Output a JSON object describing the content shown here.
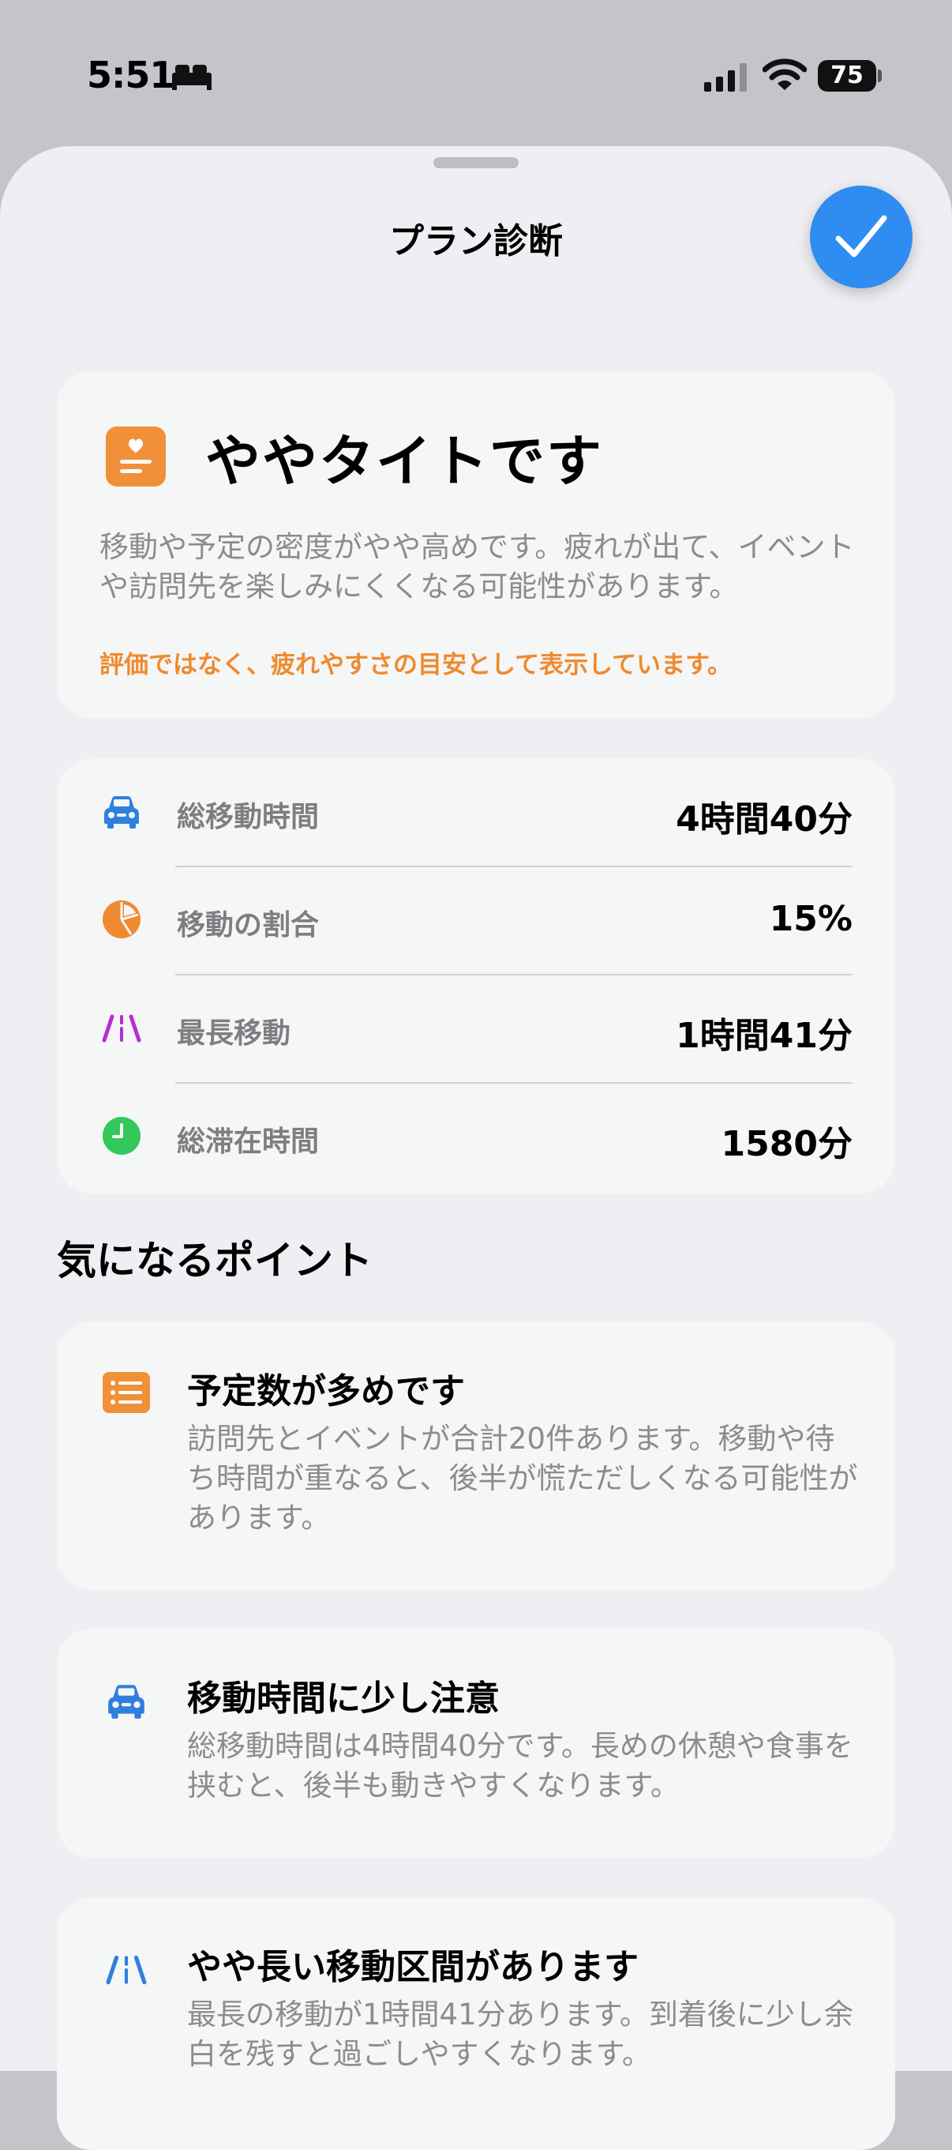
{
  "status_bar": {
    "time": "5:51",
    "battery": "75"
  },
  "sheet": {
    "title": "プラン診断"
  },
  "summary": {
    "title": "ややタイトです",
    "description": "移動や予定の密度がやや高めです。疲れが出て、イベントや訪問先を楽しみにくくなる可能性があります。",
    "note": "評価ではなく、疲れやすさの目安として表示しています。",
    "icon": "heart-document-icon",
    "accent": "#f0913a"
  },
  "stats": [
    {
      "icon": "car-icon",
      "color": "#2f7fe0",
      "label": "総移動時間",
      "value": "4時間40分"
    },
    {
      "icon": "pie-chart-icon",
      "color": "#f08a30",
      "label": "移動の割合",
      "value": "15%"
    },
    {
      "icon": "road-icon",
      "color": "#b42fd0",
      "label": "最長移動",
      "value": "1時間41分"
    },
    {
      "icon": "clock-icon",
      "color": "#34c759",
      "label": "総滞在時間",
      "value": "1580分"
    }
  ],
  "points_section": {
    "title": "気になるポイント"
  },
  "points": [
    {
      "icon": "list-icon",
      "title": "予定数が多めです",
      "description": "訪問先とイベントが合計20件あります。移動や待ち時間が重なると、後半が慌ただしくなる可能性があります。"
    },
    {
      "icon": "car-icon",
      "title": "移動時間に少し注意",
      "description": "総移動時間は4時間40分です。長めの休憩や食事を挟むと、後半も動きやすくなります。"
    },
    {
      "icon": "road-icon",
      "title": "やや長い移動区間があります",
      "description": "最長の移動が1時間41分あります。到着後に少し余白を残すと過ごしやすくなります。"
    }
  ]
}
